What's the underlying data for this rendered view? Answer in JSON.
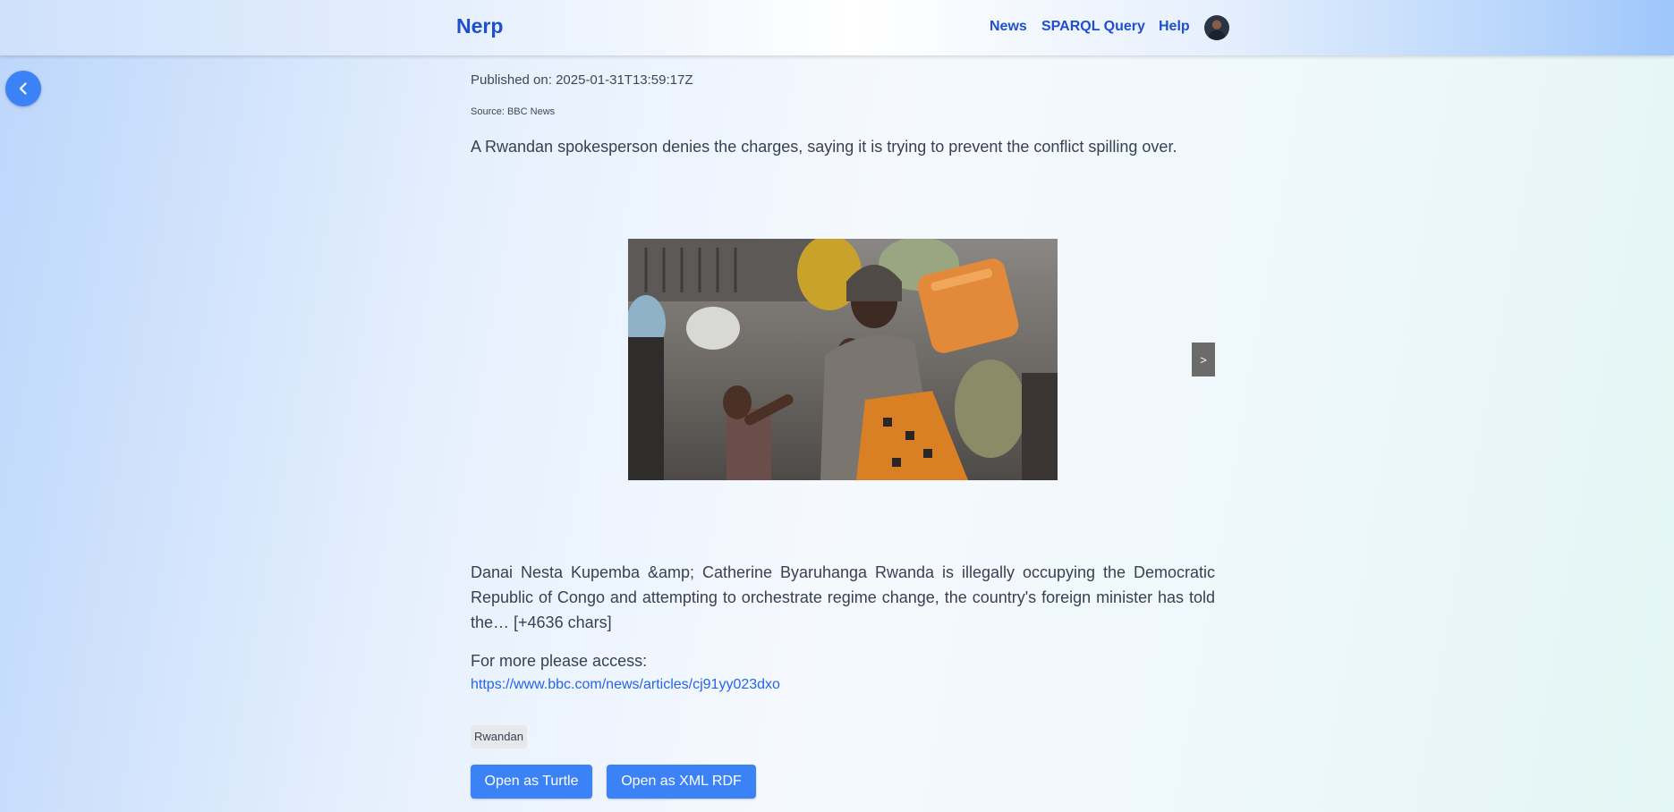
{
  "header": {
    "brand": "Nerp",
    "nav": [
      {
        "label": "News"
      },
      {
        "label": "SPARQL Query"
      },
      {
        "label": "Help"
      }
    ]
  },
  "article": {
    "published": "Published on: 2025-01-31T13:59:17Z",
    "source": "Source: BBC News",
    "summary": "A Rwandan spokesperson denies the charges, saying it is trying to prevent the conflict spilling over.",
    "carousel_next": ">",
    "content": "Danai Nesta Kupemba &amp; Catherine Byaruhanga Rwanda is illegally occupying the Democratic Republic of Congo and attempting to orchestrate regime change, the country's foreign minister has told the… [+4636 chars]",
    "more_label": "For more please access:",
    "more_url": "https://www.bbc.com/news/articles/cj91yy023dxo",
    "tags": [
      "Rwandan"
    ]
  },
  "actions": {
    "turtle": "Open as Turtle",
    "xml_rdf": "Open as XML RDF"
  },
  "colors": {
    "accent": "#3b82f6",
    "brand": "#1e4fd0",
    "link": "#2563eb"
  },
  "icons": {
    "back": "chevron-left-icon",
    "avatar": "avatar"
  }
}
